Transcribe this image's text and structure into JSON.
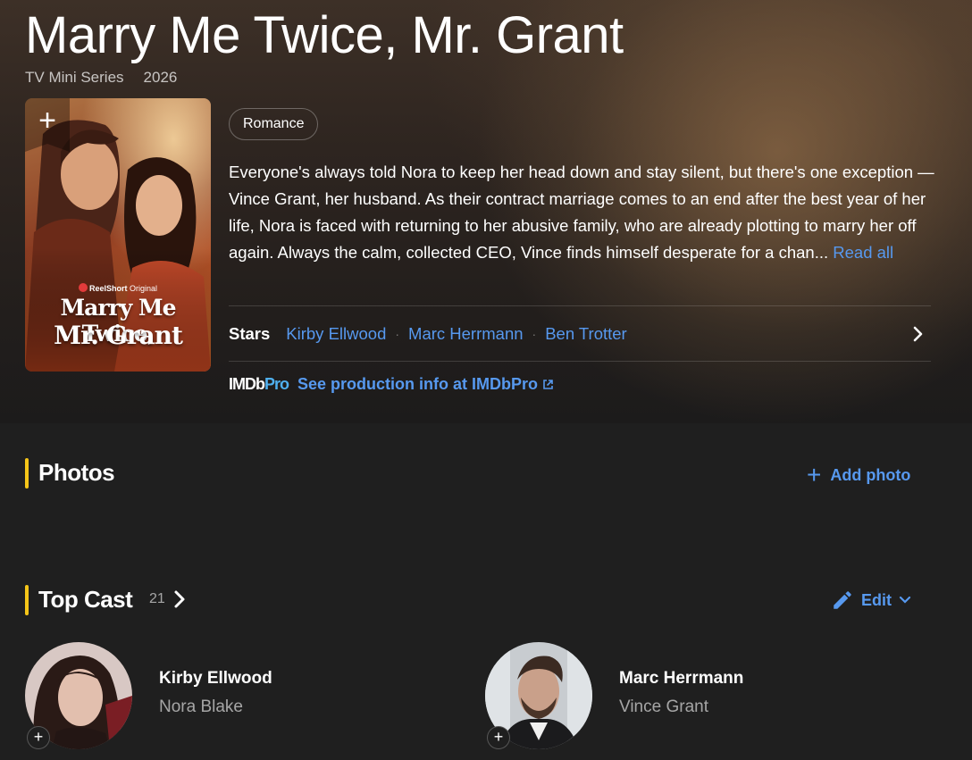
{
  "title": "Marry Me Twice, Mr. Grant",
  "meta": {
    "type": "TV Mini Series",
    "year": "2026"
  },
  "poster": {
    "brand_prefix": "ReelShort",
    "brand_suffix": "Original",
    "title_line1": "Marry Me Twice,",
    "title_line2": "Mr. Grant",
    "add_icon": "plus-icon"
  },
  "genre": "Romance",
  "plot": {
    "text": "Everyone's always told Nora to keep her head down and stay silent, but there's one exception — Vince Grant, her husband. As their contract marriage comes to an end after the best year of her life, Nora is faced with returning to her abusive family, who are already plotting to marry her off again. Always the calm, collected CEO, Vince finds himself desperate for a chan...",
    "read_more": "Read all"
  },
  "stars": {
    "label": "Stars",
    "names": [
      "Kirby Ellwood",
      "Marc Herrmann",
      "Ben Trotter"
    ],
    "separator": "·"
  },
  "imdbpro": {
    "logo_a": "IMDb",
    "logo_b": "Pro",
    "link": "See production info at IMDbPro"
  },
  "photos": {
    "title": "Photos",
    "add_label": "Add photo",
    "add_icon": "+"
  },
  "top_cast": {
    "title": "Top Cast",
    "count": "21",
    "edit_label": "Edit",
    "members": [
      {
        "name": "Kirby Ellwood",
        "role": "Nora Blake",
        "add": "+"
      },
      {
        "name": "Marc Herrmann",
        "role": "Vince Grant",
        "add": "+"
      }
    ]
  },
  "colors": {
    "link": "#5799ef",
    "accent": "#f5c518",
    "background": "#1f1f1f"
  }
}
